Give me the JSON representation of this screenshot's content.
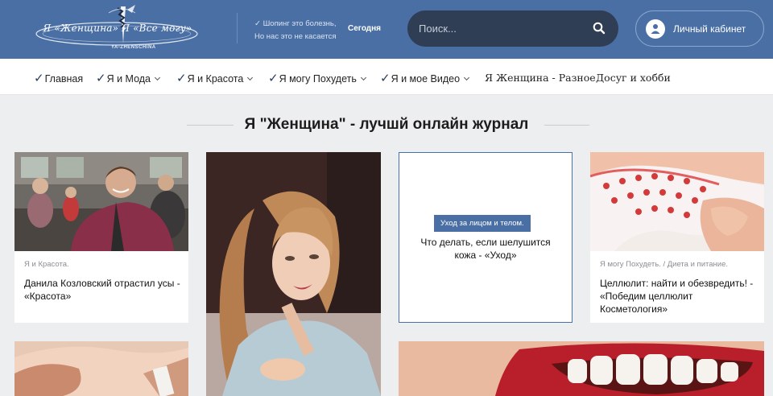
{
  "header": {
    "logo_text": "Я «Женщина» Я «Все могу»",
    "logo_sub": "YA-ZHENSCHINA",
    "slogan_line1": "✓ Шопинг это болезнь,",
    "slogan_line2": "Но нас это не касается",
    "today_label": "Сегодня",
    "search_placeholder": "Поиск...",
    "account_label": "Личный кабинет"
  },
  "nav": {
    "items": [
      {
        "label": "Главная",
        "check": "✓",
        "dropdown": false
      },
      {
        "label": "Я и Мода",
        "check": "✓",
        "dropdown": true
      },
      {
        "label": "Я и Красота",
        "check": "✓",
        "dropdown": true
      },
      {
        "label": "Я могу Похудеть",
        "check": "✓",
        "dropdown": true
      },
      {
        "label": "Я и мое Видео",
        "check": "✓",
        "dropdown": true
      },
      {
        "label": "Я Женщина - Разное",
        "check": "",
        "dropdown": false
      },
      {
        "label": "Досуг и хобби",
        "check": "",
        "dropdown": false
      }
    ]
  },
  "main": {
    "section_title": "Я \"Женщина\" - лучшй онлайн журнал",
    "cards": [
      {
        "category": "Я и Красота.",
        "title": "Данила Козловский отрастил усы - «Красота»"
      },
      {
        "tag": "Уход за лицом и телом.",
        "title": "Что делать, если шелушится кожа - «Уход»"
      },
      {
        "category": "Я могу Похудеть. / Диета и питание.",
        "title": "Целлюлит: найти и обезвредить! - «Победим целлюлит Косметология»"
      }
    ]
  },
  "colors": {
    "header_bg": "#4a6fa5",
    "search_bg": "#2f3e55",
    "tag_bg": "#4a6fa5",
    "page_bg": "#edeef0"
  }
}
